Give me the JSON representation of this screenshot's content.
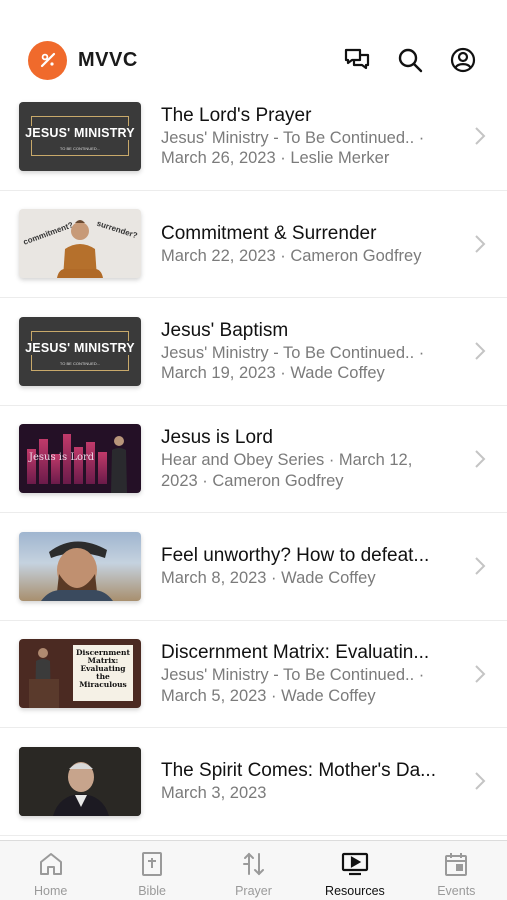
{
  "header": {
    "app_title": "MVVC",
    "icons": [
      "chat-icon",
      "search-icon",
      "profile-icon"
    ]
  },
  "items": [
    {
      "title": "The Lord's Prayer",
      "sub1": "Jesus' Ministry - To Be Continued.. ·",
      "sub2": "March 26, 2023 · Leslie Merker",
      "thumb": "ministry",
      "thumb_text": "JESUS' MINISTRY",
      "thumb_small": "TO BE CONTINUED..."
    },
    {
      "title": "Commitment & Surrender",
      "sub1": "March 22, 2023 · Cameron Godfrey",
      "sub2": "",
      "thumb": "commit",
      "thumb_text": "commitment?",
      "thumb_small": "surrender?"
    },
    {
      "title": "Jesus' Baptism",
      "sub1": "Jesus' Ministry - To Be Continued.. ·",
      "sub2": "March 19, 2023 · Wade Coffey",
      "thumb": "ministry",
      "thumb_text": "JESUS' MINISTRY",
      "thumb_small": "TO BE CONTINUED..."
    },
    {
      "title": "Jesus is Lord",
      "sub1": "Hear and Obey Series · March 12,",
      "sub2": "2023 · Cameron Godfrey",
      "thumb": "lord",
      "thumb_text": "Jesus is Lord",
      "thumb_small": ""
    },
    {
      "title": "Feel unworthy? How to defeat...",
      "sub1": "March 8, 2023 · Wade Coffey",
      "sub2": "",
      "thumb": "unworthy",
      "thumb_text": "",
      "thumb_small": ""
    },
    {
      "title": "Discernment Matrix: Evaluatin...",
      "sub1": "Jesus' Ministry - To Be Continued.. ·",
      "sub2": "March 5, 2023 · Wade Coffey",
      "thumb": "discern",
      "thumb_text": "Discernment Matrix: Evaluating the Miraculous",
      "thumb_small": ""
    },
    {
      "title": "The Spirit Comes: Mother's Da...",
      "sub1": "March 3, 2023",
      "sub2": "",
      "thumb": "spirit",
      "thumb_text": "",
      "thumb_small": ""
    }
  ],
  "tabs": [
    {
      "label": "Home",
      "icon": "home-icon",
      "active": false
    },
    {
      "label": "Bible",
      "icon": "bible-icon",
      "active": false
    },
    {
      "label": "Prayer",
      "icon": "prayer-icon",
      "active": false
    },
    {
      "label": "Resources",
      "icon": "resources-icon",
      "active": true
    },
    {
      "label": "Events",
      "icon": "events-icon",
      "active": false
    }
  ],
  "colors": {
    "brand": "#f06a2c",
    "active_tab": "#111111",
    "inactive_tab": "#9a9a9a",
    "secondary_text": "#7b7b7b"
  }
}
